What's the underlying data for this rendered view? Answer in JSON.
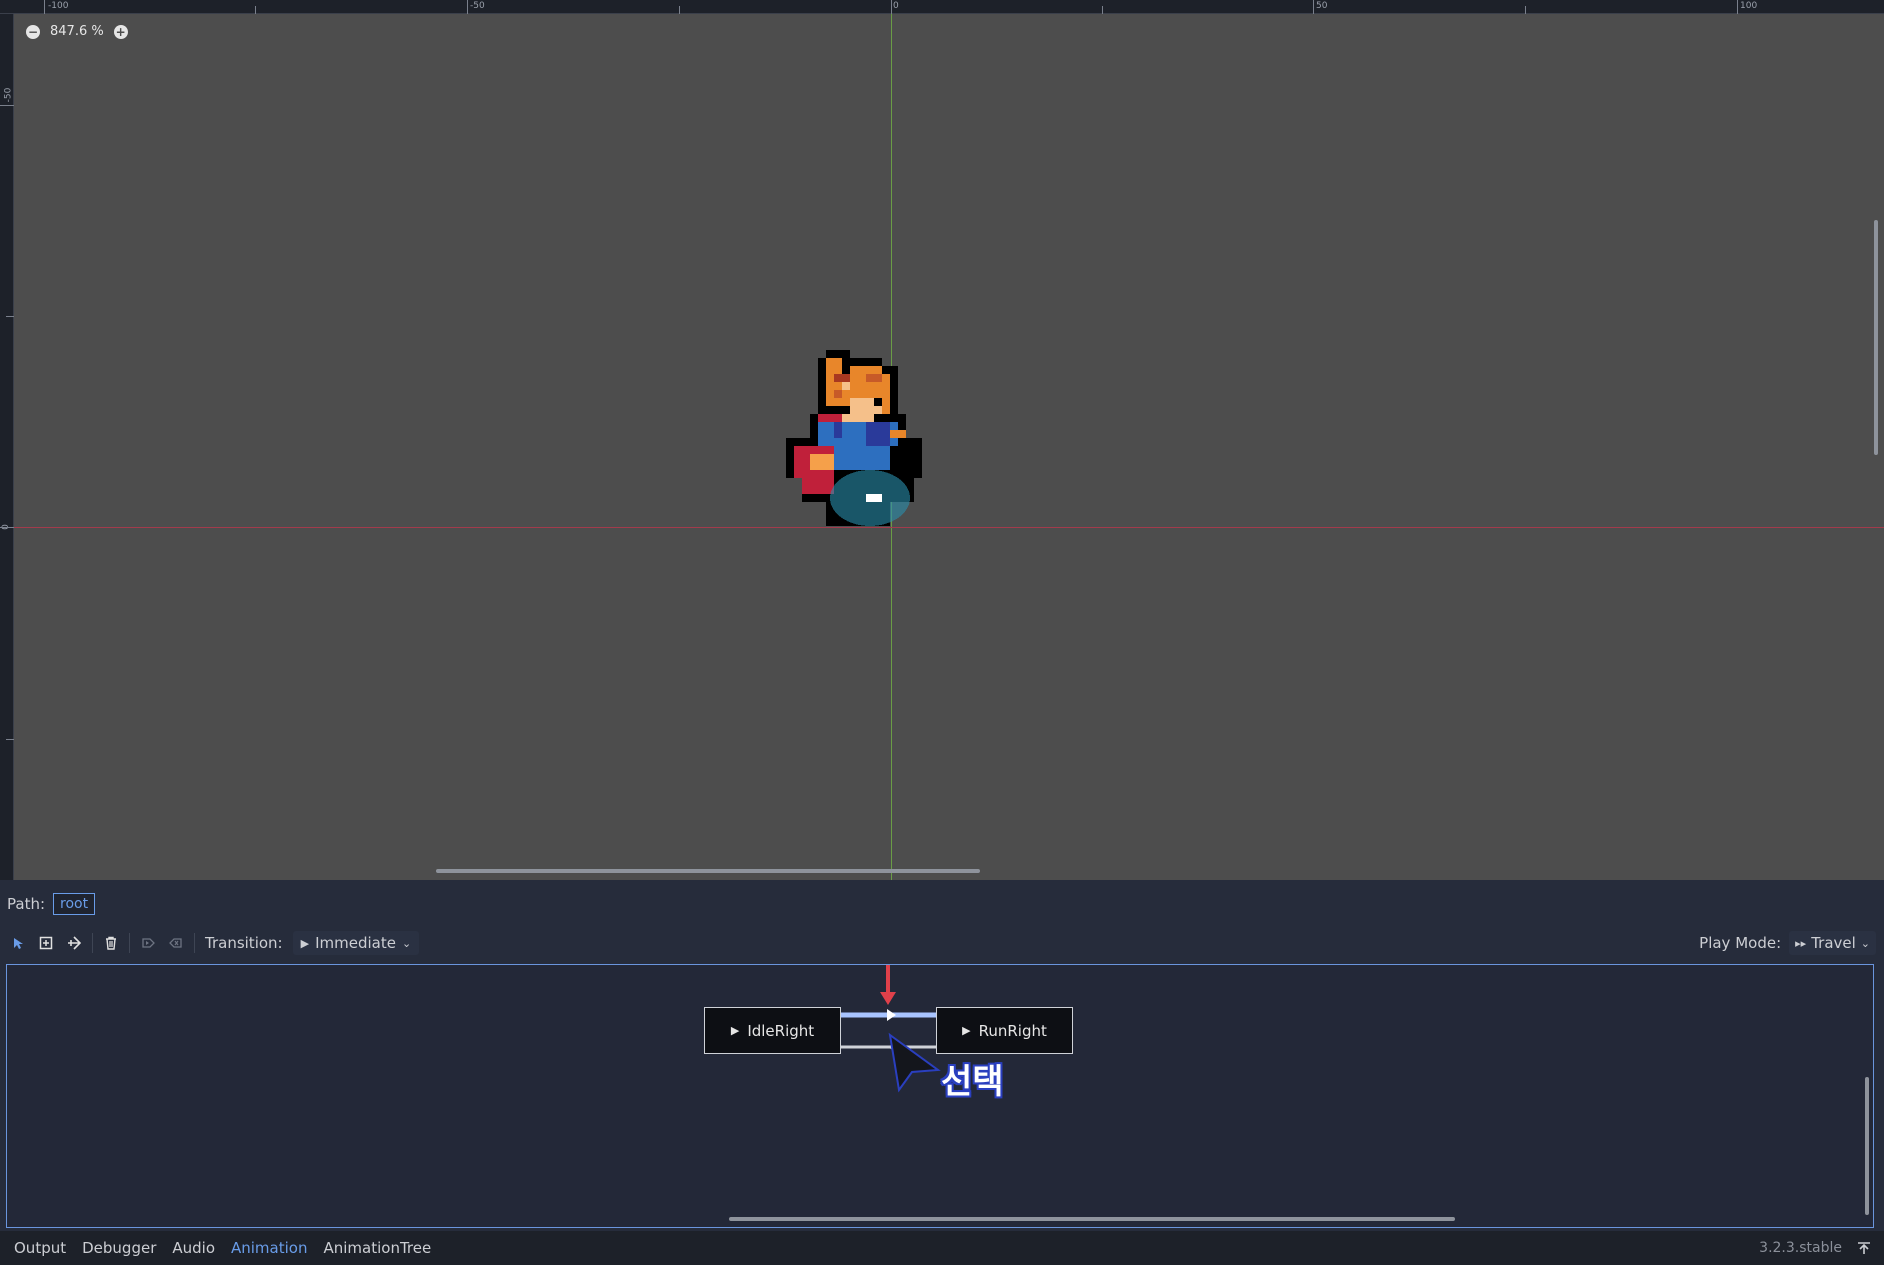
{
  "viewport": {
    "zoom_level": "847.6 %",
    "ruler_top_labels": [
      "-100",
      "-50",
      "0",
      "50",
      "100"
    ],
    "ruler_left_labels": [
      "-50",
      "0"
    ]
  },
  "panel": {
    "path_label": "Path:",
    "path_value": "root",
    "toolbar": {
      "tools": [
        "select-tool-icon",
        "create-node-icon",
        "connect-nodes-icon",
        "delete-icon",
        "set-start-icon",
        "set-end-icon"
      ],
      "transition_label": "Transition:",
      "transition_value": "Immediate",
      "play_mode_label": "Play Mode:",
      "play_mode_value": "Travel"
    },
    "graph": {
      "nodes": [
        {
          "label": "IdleRight"
        },
        {
          "label": "RunRight"
        }
      ],
      "annotation": "선택",
      "colors": {
        "selected_transition": "#a8c4ff",
        "transition": "#cfd2d8",
        "highlight_arrow": "#e0404a"
      }
    }
  },
  "dock": {
    "tabs": [
      {
        "label": "Output",
        "active": false
      },
      {
        "label": "Debugger",
        "active": false
      },
      {
        "label": "Audio",
        "active": false
      },
      {
        "label": "Animation",
        "active": true
      },
      {
        "label": "AnimationTree",
        "active": false
      }
    ],
    "version": "3.2.3.stable"
  },
  "colors": {
    "accent": "#699ce8",
    "viewport_bg": "#4d4d4d",
    "panel_bg": "#262c3b"
  }
}
